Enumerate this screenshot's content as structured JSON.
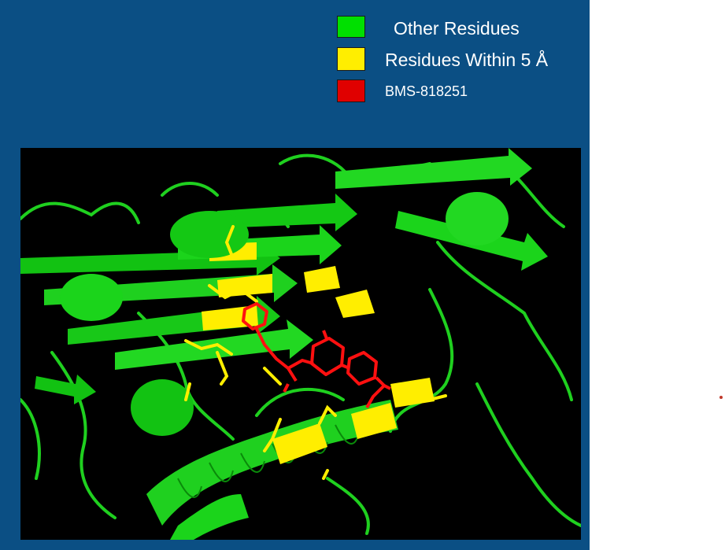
{
  "colors": {
    "panel_background": "#0b4f84",
    "viewer_background": "#000000",
    "other_residues": "#00e000",
    "residues_within": "#ffee00",
    "ligand": "#e00000"
  },
  "legend": {
    "items": [
      {
        "label": "Other Residues",
        "color": "#00e000"
      },
      {
        "label": "Residues Within 5 Å",
        "color": "#ffee00"
      },
      {
        "label": "BMS-818251",
        "color": "#e00000"
      }
    ]
  }
}
